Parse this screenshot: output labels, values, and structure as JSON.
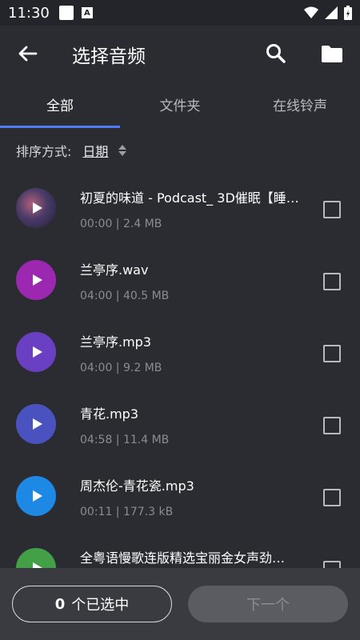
{
  "status": {
    "time": "11:30",
    "a_label": "A"
  },
  "appbar": {
    "title": "选择音频"
  },
  "tabs": [
    {
      "label": "全部",
      "active": true
    },
    {
      "label": "文件夹",
      "active": false
    },
    {
      "label": "在线铃声",
      "active": false
    }
  ],
  "sort": {
    "label": "排序方式:",
    "value": "日期"
  },
  "files": [
    {
      "title": "初夏的味道 - Podcast_ 3D催眠【睡…",
      "meta": "00:00 | 2.4 MB",
      "color": "#5a3a5c",
      "checked": false
    },
    {
      "title": "兰亭序.wav",
      "meta": "04:00 | 40.5 MB",
      "color": "#9c27b0",
      "checked": false
    },
    {
      "title": "兰亭序.mp3",
      "meta": "04:00 | 9.2 MB",
      "color": "#6a3fc1",
      "checked": false
    },
    {
      "title": "青花.mp3",
      "meta": "04:58 | 11.4 MB",
      "color": "#4a52c0",
      "checked": false
    },
    {
      "title": "周杰伦-青花瓷.mp3",
      "meta": "00:11 | 177.3 kB",
      "color": "#1e88e5",
      "checked": false
    },
    {
      "title": "全粤语慢歌连版精选宝丽金女声劲…",
      "meta": "",
      "color": "#43a047",
      "checked": false
    }
  ],
  "bottom": {
    "selected_count": "0",
    "selected_suffix": "个已选中",
    "next_label": "下一个"
  },
  "colors": {
    "accent": "#4f7cf2",
    "background": "#2b2c31",
    "bottom_bar": "#3a3b41"
  }
}
